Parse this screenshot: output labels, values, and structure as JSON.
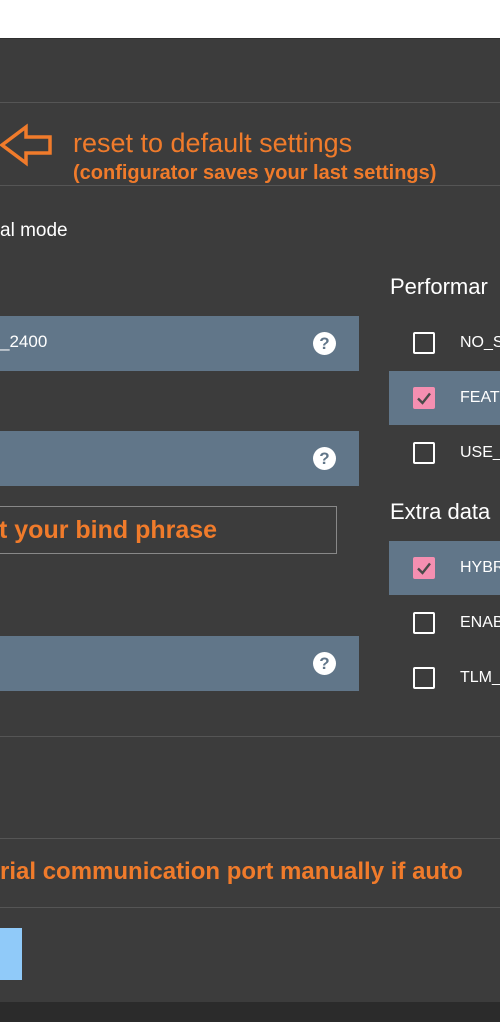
{
  "annotations": {
    "reset_line1": "reset to default settings",
    "reset_line2": "(configurator saves your last settings)",
    "bind_phrase_hint": "t your bind phrase",
    "serial_port_hint": "rial communication port manually if auto"
  },
  "mode": {
    "label": "al mode"
  },
  "fields": {
    "field1_value": "_2400",
    "field2_value": "",
    "field3_value": "",
    "help_glyph": "?"
  },
  "sections": {
    "performance_title": "Performar",
    "extra_data_title": "Extra data"
  },
  "performance_options": [
    {
      "label": "NO_S",
      "checked": false
    },
    {
      "label": "FEAT",
      "checked": true
    },
    {
      "label": "USE_",
      "checked": false
    }
  ],
  "extra_data_options": [
    {
      "label": "HYBR",
      "checked": true
    },
    {
      "label": "ENAB",
      "checked": false
    },
    {
      "label": "TLM_",
      "checked": false
    }
  ],
  "colors": {
    "background": "#3c3c3c",
    "field": "#617689",
    "annotation": "#f07b2b",
    "checkbox_on": "#f48fb1",
    "button": "#90caf9"
  },
  "icons": {
    "arrow": "left-arrow-annotation-icon",
    "help": "help-icon",
    "check": "checkmark-icon"
  }
}
